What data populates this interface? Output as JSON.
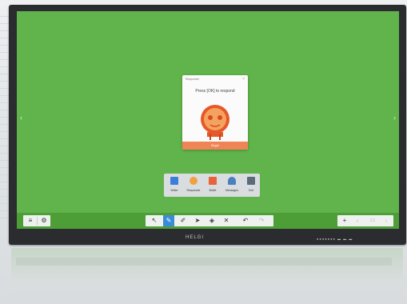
{
  "dialog": {
    "title": "Responder",
    "close": "×",
    "message": "Press [OK] to respond",
    "button_label": "Begin"
  },
  "tools": [
    {
      "label": "Writer",
      "icon": "grid-icon",
      "color": "#3d7fd6"
    },
    {
      "label": "Responder",
      "icon": "buzzer-icon",
      "color": "#f0a040"
    },
    {
      "label": "Bullet",
      "icon": "chat-icon",
      "color": "#e8623a"
    },
    {
      "label": "Messages",
      "icon": "person-icon",
      "color": "#4a7fc0"
    },
    {
      "label": "Exit",
      "icon": "exit-icon",
      "color": "#5a6b7a"
    }
  ],
  "bottom_left": {
    "menu": "≡",
    "settings": "⚙"
  },
  "bottom_center": [
    "select-arrow-icon",
    "pen-icon",
    "highlighter-icon",
    "pointer-icon",
    "shapes-icon",
    "cross-icon",
    "undo-icon",
    "redo-icon"
  ],
  "bottom_right": {
    "add": "+",
    "prev": "‹",
    "page": "1/1",
    "next": "›"
  },
  "brand": "HELGI",
  "colors": {
    "screen": "#61b34b",
    "accent": "#ef8556"
  }
}
